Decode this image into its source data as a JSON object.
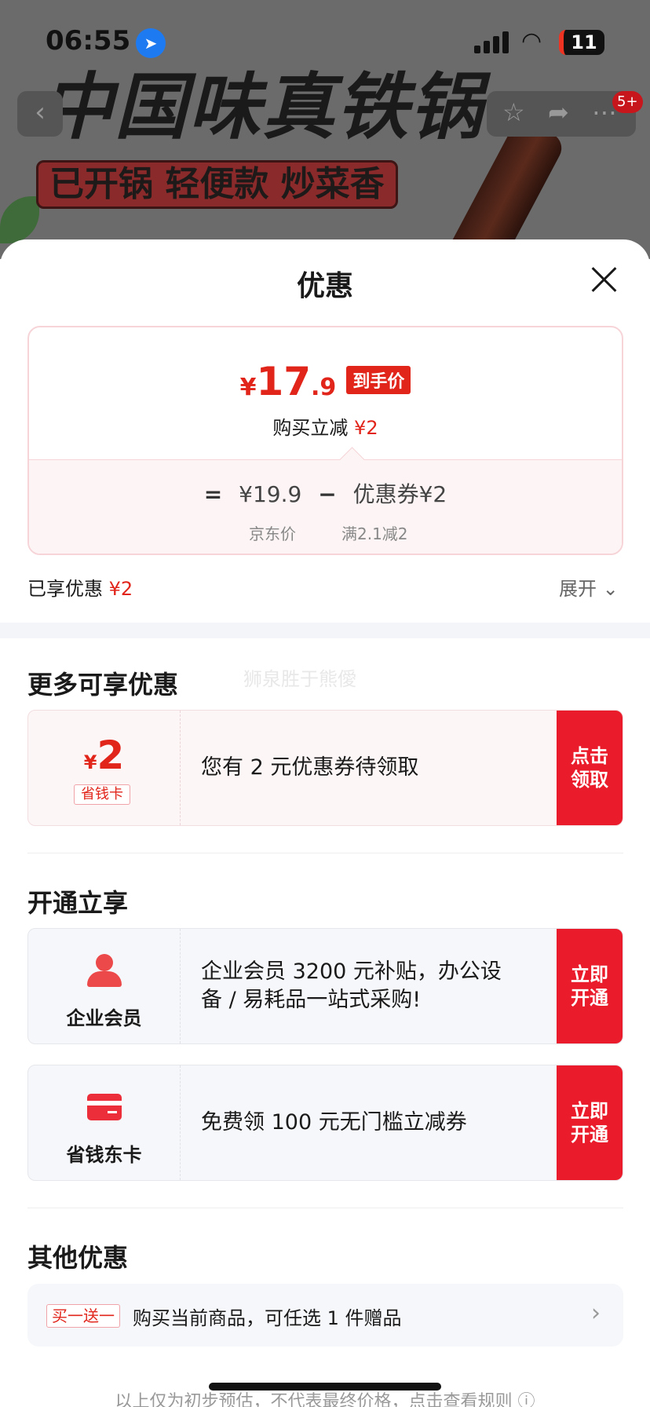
{
  "status_bar": {
    "time": "06:55",
    "battery": "11"
  },
  "banner": {
    "title_art": "中国味真铁锅",
    "slogan": "已开锅 轻便款 炒菜香",
    "more_badge": "5+"
  },
  "sheet": {
    "title": "优惠",
    "price_card": {
      "yen": "¥",
      "price_int": "17",
      "price_dec": ".9",
      "price_tag": "到手价",
      "discount_label": "购买立减",
      "discount_value": "¥2",
      "formula_eq": "=",
      "jd_price": "¥19.9",
      "formula_minus": "−",
      "coupon_part": "优惠券¥2",
      "jd_price_label": "京东价",
      "coupon_condition": "满2.1减2"
    },
    "enjoyed_label": "已享优惠",
    "enjoyed_value": "¥2",
    "expand_label": "展开",
    "more_offers": {
      "title": "更多可享优惠",
      "watermark": "狮泉胜于熊僾",
      "coupon": {
        "yen": "¥",
        "amount": "2",
        "label": "省钱卡",
        "text": "您有 2 元优惠券待领取",
        "button": "点击 领取"
      }
    },
    "open_enjoy": {
      "title": "开通立享",
      "cards": [
        {
          "label": "企业会员",
          "icon": "person-icon",
          "text": "企业会员 3200 元补贴，办公设备 / 易耗品一站式采购!",
          "button": "立即 开通"
        },
        {
          "label": "省钱东卡",
          "icon": "card-icon",
          "text": "免费领 100 元无门槛立减券",
          "button": "立即 开通"
        }
      ]
    },
    "other_offers": {
      "title": "其他优惠",
      "tag": "买一送一",
      "text": "购买当前商品，可任选 1 件赠品"
    },
    "footnote": "以上仅为初步预估，不代表最终价格，点击查看规则 ⓘ"
  },
  "colors": {
    "accent_red": "#e1251b",
    "button_red": "#ea1c2b"
  }
}
